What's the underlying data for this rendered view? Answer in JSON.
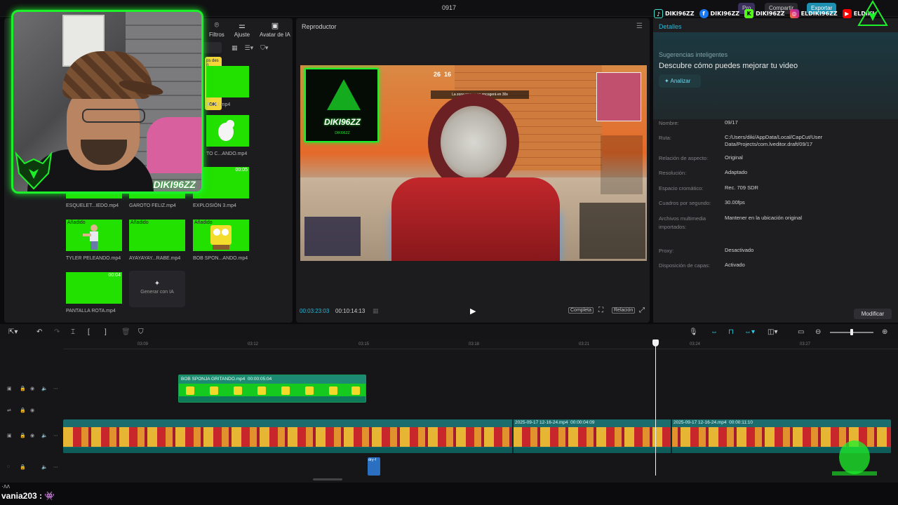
{
  "window": {
    "title": "0917",
    "pro_label": "Pro",
    "share_label": "Compartir",
    "export_label": "Exportar"
  },
  "social": [
    {
      "icon": "tiktok-icon",
      "handle": "DIKI96ZZ",
      "glyph": "♪"
    },
    {
      "icon": "facebook-icon",
      "handle": "DIKI96ZZ",
      "glyph": "f"
    },
    {
      "icon": "kick-icon",
      "handle": "DIKI96ZZ",
      "glyph": "K"
    },
    {
      "icon": "instagram-icon",
      "handle": "ELDIKI96ZZ",
      "glyph": "◎"
    },
    {
      "icon": "youtube-icon",
      "handle": "ELDIKI",
      "glyph": "▶"
    }
  ],
  "webcam": {
    "name": "DIKI96ZZ"
  },
  "media": {
    "tools": [
      {
        "icon": "filters-icon",
        "glyph": "⌾",
        "label": "Filtros"
      },
      {
        "icon": "adjust-icon",
        "glyph": "⚌",
        "label": "Ajuste"
      },
      {
        "icon": "ai-avatar-icon",
        "glyph": "▣",
        "label": "Avatar de IA"
      }
    ],
    "popup_text": "ps des n",
    "popup_ok": "OK",
    "clips_top": [
      {
        "name": "JUUU.mp4"
      },
      {
        "name": "TO C...ANDO.mp4"
      },
      {
        "name": "EXPLOSIÓN 3.mp4",
        "duration": "00:05"
      }
    ],
    "clips_mid": [
      {
        "name": "ESQUELET...IEDO.mp4"
      },
      {
        "name": "GAROTO FELIZ.mp4"
      }
    ],
    "clips_row3": [
      {
        "name": "TYLER PELEANDO.mp4",
        "badge": "Añadido"
      },
      {
        "name": "AYAYAYAY...RABE.mp4",
        "badge": "Añadido"
      },
      {
        "name": "BOB SPON...ANDO.mp4",
        "badge": "Añadido"
      }
    ],
    "clip_broken": {
      "name": "PANTALLA ROTA.mp4",
      "duration": "00:04"
    },
    "generate_label": "Generar con IA"
  },
  "player": {
    "title": "Reproductor",
    "current_time": "00:03:23:03",
    "total_time": "00:10:14:13",
    "full_label": "Completa",
    "ratio_label": "Relación",
    "game": {
      "logo_text": "DIKI96ZZ",
      "logo_sub": "DIKI96ZZ",
      "banner": "La zona segura se encogerá en 30s",
      "kills": "26",
      "alive": "16"
    }
  },
  "details": {
    "tab": "Detalles",
    "suggestions_title": "Sugerencias inteligentes",
    "discover": "Descubre cómo puedes mejorar tu video",
    "analyze_label": "Analizar",
    "rows": [
      {
        "k": "Nombre:",
        "v": "09/17"
      },
      {
        "k": "Ruta:",
        "v": "C:/Users/diki/AppData/Local/CapCut/User Data/Projects/com.lveditor.draft/09/17"
      },
      {
        "k": "Relación de aspecto:",
        "v": "Original"
      },
      {
        "k": "Resolución:",
        "v": "Adaptado"
      },
      {
        "k": "Espacio cromático:",
        "v": "Rec. 709 SDR"
      },
      {
        "k": "Cuadros por segundo:",
        "v": "30.00fps"
      },
      {
        "k": "Archivos multimedia importados:",
        "v": "Mantener en la ubicación original"
      },
      {
        "k": "Proxy:",
        "v": "Desactivado"
      },
      {
        "k": "Disposición de capas:",
        "v": "Activado"
      }
    ],
    "modify_label": "Modificar"
  },
  "timeline": {
    "ruler": [
      "03:09",
      "03:12",
      "03:15",
      "03:18",
      "03:21",
      "03:24",
      "03:27"
    ],
    "overlay_clip": {
      "name": "BOB SPONJA GRITANDO.mp4",
      "duration": "00:00:05:04"
    },
    "main_segments": [
      {
        "name": "2025-09-17 12-16-24.mp4",
        "duration": "00:00:04:09"
      },
      {
        "name": "2025-09-17 12-16-24.mp4",
        "duration": "00:00:11:10"
      }
    ],
    "audio_clip": "dry-f"
  },
  "chat": {
    "line1": "·ʌʌ",
    "line2": "vania203 : ",
    "emote": "👾"
  },
  "colors": {
    "accent": "#2bb8d9",
    "green_screen": "#22e000",
    "neon": "#1cf02a"
  }
}
